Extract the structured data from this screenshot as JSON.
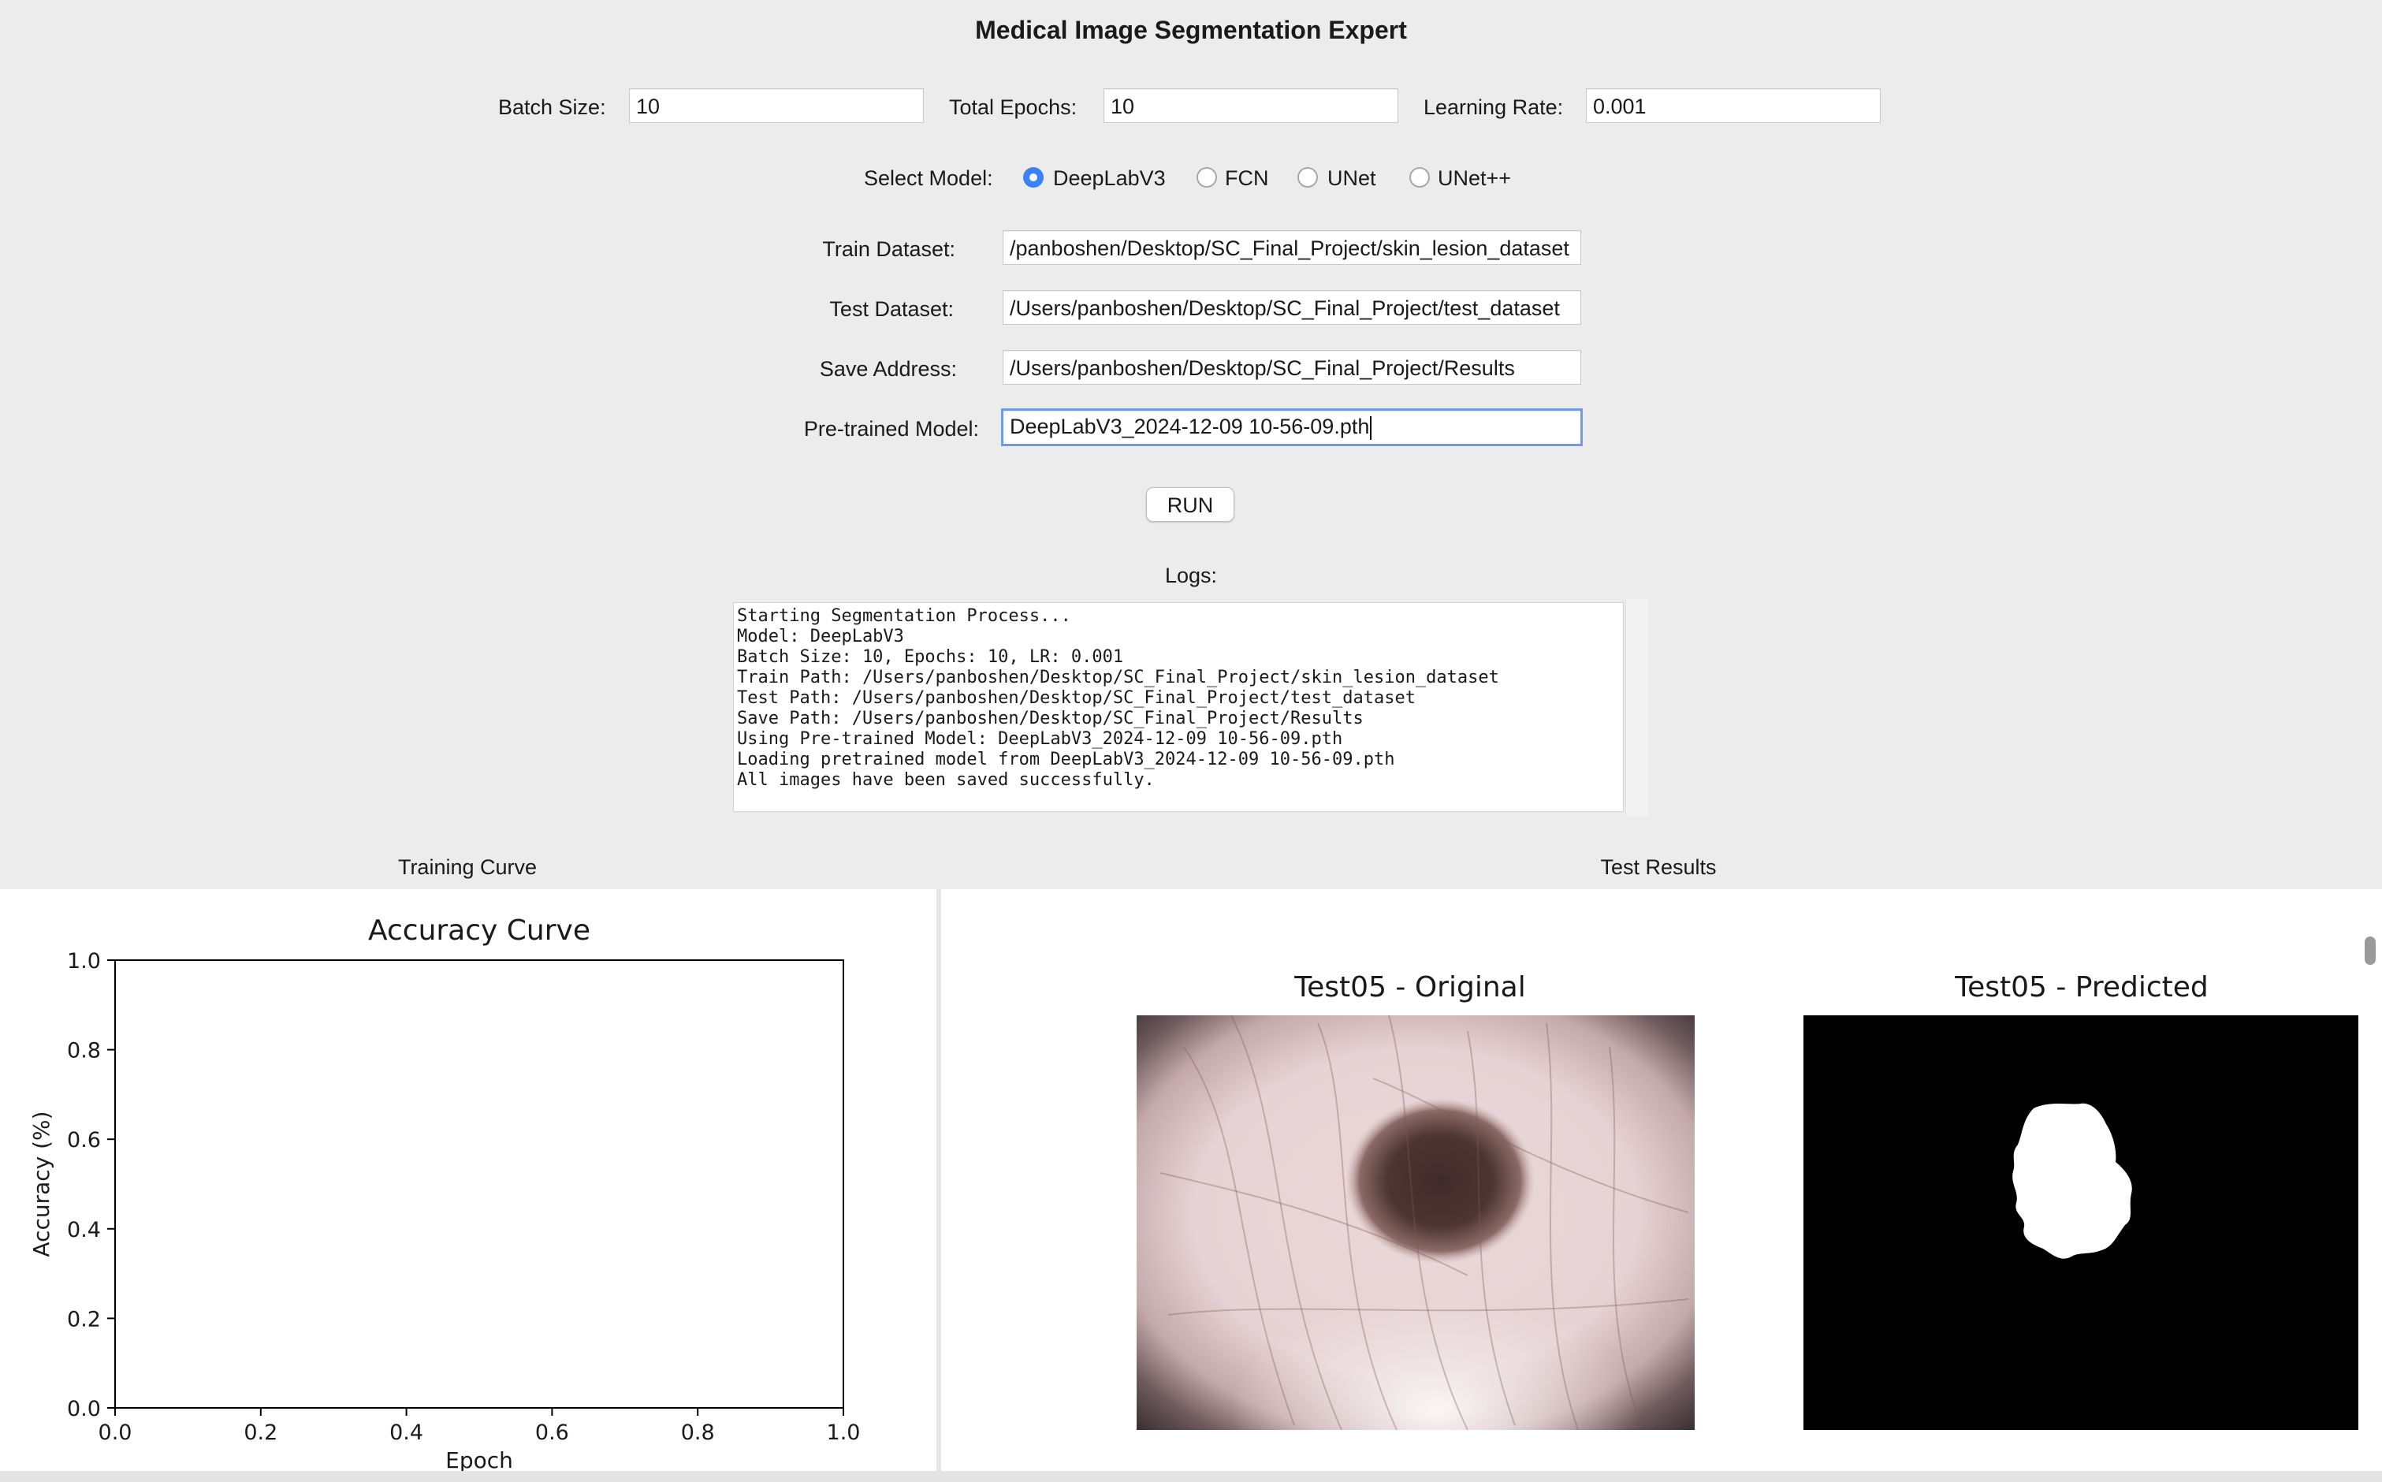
{
  "app": {
    "title": "Medical Image Segmentation Expert"
  },
  "params": {
    "batch_size": {
      "label": "Batch Size:",
      "value": "10"
    },
    "total_epochs": {
      "label": "Total Epochs:",
      "value": "10"
    },
    "learning_rate": {
      "label": "Learning Rate:",
      "value": "0.001"
    }
  },
  "model_select": {
    "label": "Select Model:",
    "options": [
      "DeepLabV3",
      "FCN",
      "UNet",
      "UNet++"
    ],
    "selected": "DeepLabV3"
  },
  "paths": {
    "train": {
      "label": "Train Dataset:",
      "value": "/panboshen/Desktop/SC_Final_Project/skin_lesion_dataset"
    },
    "test": {
      "label": "Test Dataset:",
      "value": "/Users/panboshen/Desktop/SC_Final_Project/test_dataset"
    },
    "save": {
      "label": "Save Address:",
      "value": "/Users/panboshen/Desktop/SC_Final_Project/Results"
    },
    "pretrained": {
      "label": "Pre-trained Model:",
      "value": "DeepLabV3_2024-12-09 10-56-09.pth"
    }
  },
  "run_button": "RUN",
  "logs": {
    "label": "Logs:",
    "lines": [
      "Starting Segmentation Process...",
      "Model: DeepLabV3",
      "Batch Size: 10, Epochs: 10, LR: 0.001",
      "Train Path: /Users/panboshen/Desktop/SC_Final_Project/skin_lesion_dataset",
      "Test Path: /Users/panboshen/Desktop/SC_Final_Project/test_dataset",
      "Save Path: /Users/panboshen/Desktop/SC_Final_Project/Results",
      "Using Pre-trained Model: DeepLabV3_2024-12-09 10-56-09.pth",
      "Loading pretrained model from DeepLabV3_2024-12-09 10-56-09.pth",
      "All images have been saved successfully."
    ]
  },
  "sections": {
    "training_curve": "Training Curve",
    "test_results": "Test Results"
  },
  "chart_data": {
    "type": "line",
    "title": "Accuracy Curve",
    "xlabel": "Epoch",
    "ylabel": "Accuracy (%)",
    "xlim": [
      0.0,
      1.0
    ],
    "ylim": [
      0.0,
      1.0
    ],
    "xticks": [
      "0.0",
      "0.2",
      "0.4",
      "0.6",
      "0.8",
      "1.0"
    ],
    "yticks": [
      "0.0",
      "0.2",
      "0.4",
      "0.6",
      "0.8",
      "1.0"
    ],
    "series": [],
    "grid": false
  },
  "test_results": {
    "original_title": "Test05 - Original",
    "predicted_title": "Test05 - Predicted"
  },
  "colors": {
    "accent": "#3b82f6",
    "focus_ring": "#6f9be8",
    "background": "#ececec"
  }
}
